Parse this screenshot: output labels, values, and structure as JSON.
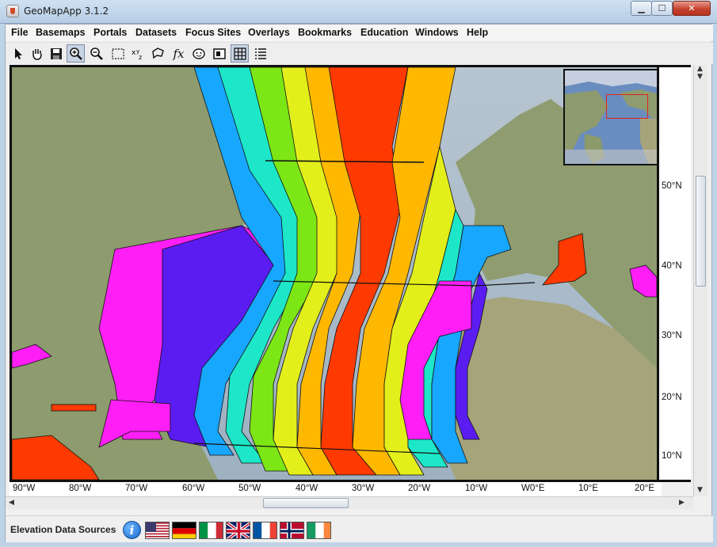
{
  "window": {
    "title": "GeoMapApp 3.1.2",
    "min": "▁",
    "max": "☐",
    "close": "✕"
  },
  "menu": [
    "File",
    "Basemaps",
    "Portals",
    "Datasets",
    "Focus Sites",
    "Overlays",
    "Bookmarks",
    "Education",
    "Windows",
    "Help"
  ],
  "toolbar": {
    "tools": [
      {
        "name": "select-arrow-icon",
        "glyph": "➚"
      },
      {
        "name": "pan-hand-icon",
        "glyph": "✋"
      },
      {
        "name": "save-icon",
        "glyph": ""
      },
      {
        "name": "zoom-in-icon",
        "glyph": "⊕",
        "pressed": true
      },
      {
        "name": "zoom-out-icon",
        "glyph": "⊖"
      },
      {
        "name": "rect-select-icon",
        "glyph": ""
      },
      {
        "name": "xyz-icon",
        "glyph": "xᵧz"
      },
      {
        "name": "lasso-icon",
        "glyph": ""
      },
      {
        "name": "function-icon",
        "glyph": "fx"
      },
      {
        "name": "face-icon",
        "glyph": "☺"
      },
      {
        "name": "split-view-icon",
        "glyph": ""
      },
      {
        "name": "grid-icon",
        "glyph": "",
        "pressed": true
      },
      {
        "name": "list-icon",
        "glyph": ""
      }
    ]
  },
  "map": {
    "lat_labels": [
      "50°N",
      "40°N",
      "30°N",
      "20°N",
      "10°N"
    ],
    "lon_labels": [
      "90°W",
      "80°W",
      "70°W",
      "60°W",
      "50°W",
      "40°W",
      "30°W",
      "20°W",
      "10°W",
      "W0°E",
      "10°E",
      "20°E"
    ]
  },
  "footer": {
    "elevation_label": "Elevation Data Sources",
    "info_glyph": "i",
    "flags": [
      "usa-flag",
      "germany-flag",
      "italy-flag",
      "uk-flag",
      "france-flag",
      "norway-flag",
      "ireland-flag"
    ]
  },
  "colors": {
    "accent": "#e0241b",
    "ocean": "#9fb2c4",
    "land": "#8c9a6c"
  }
}
